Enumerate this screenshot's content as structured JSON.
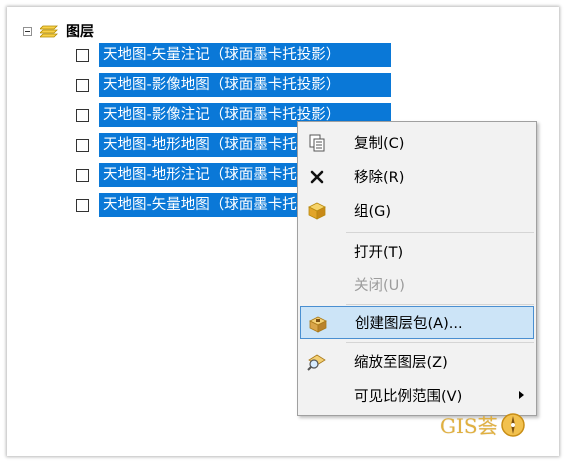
{
  "tree": {
    "root": {
      "label": "图层",
      "icon": "layers-icon"
    },
    "layers": [
      {
        "label": "天地图-矢量注记（球面墨卡托投影）",
        "checked": false
      },
      {
        "label": "天地图-影像地图（球面墨卡托投影）",
        "checked": false
      },
      {
        "label": "天地图-影像注记（球面墨卡托投影）",
        "checked": false
      },
      {
        "label": "天地图-地形地图（球面墨卡托投影）",
        "checked": false
      },
      {
        "label": "天地图-地形注记（球面墨卡托投影）",
        "checked": false
      },
      {
        "label": "天地图-矢量地图（球面墨卡托投影）",
        "checked": false
      }
    ],
    "selection_color": "#0a78d7"
  },
  "context_menu": {
    "items": [
      {
        "label": "复制(C)",
        "icon": "copy-icon",
        "enabled": true
      },
      {
        "label": "移除(R)",
        "icon": "remove-x-icon",
        "enabled": true
      },
      {
        "label": "组(G)",
        "icon": "group-layer-icon",
        "enabled": true
      },
      {
        "label": "打开(T)",
        "icon": "",
        "enabled": true
      },
      {
        "label": "关闭(U)",
        "icon": "",
        "enabled": false
      },
      {
        "label": "创建图层包(A)...",
        "icon": "layer-package-icon",
        "enabled": true,
        "highlighted": true
      },
      {
        "label": "缩放至图层(Z)",
        "icon": "zoom-to-layer-icon",
        "enabled": true
      },
      {
        "label": "可见比例范围(V)",
        "icon": "",
        "enabled": true,
        "submenu": true
      }
    ],
    "highlight_color": "#cce4f7"
  },
  "watermark": {
    "text": "GIS荟",
    "icon": "gis-logo-icon"
  }
}
